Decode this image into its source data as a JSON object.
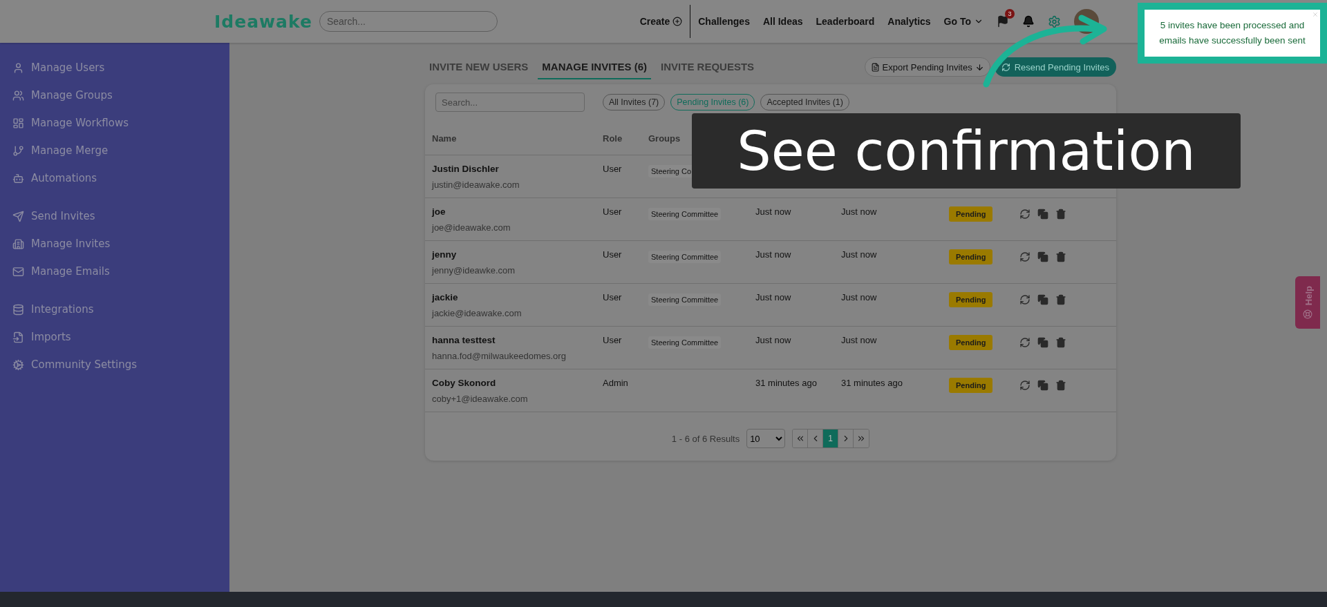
{
  "header": {
    "logo": "Ideawake",
    "search": {
      "placeholder": "Search..."
    },
    "nav": [
      {
        "label": "Create",
        "kind": "create"
      },
      {
        "label": "Challenges",
        "kind": "link"
      },
      {
        "label": "All Ideas",
        "kind": "link"
      },
      {
        "label": "Leaderboard",
        "kind": "link"
      },
      {
        "label": "Analytics",
        "kind": "link"
      },
      {
        "label": "Go To",
        "kind": "dropdown"
      }
    ],
    "flag_badge": "3"
  },
  "sidebar": {
    "groups": [
      {
        "items": [
          {
            "label": "Manage Users"
          },
          {
            "label": "Manage Groups"
          },
          {
            "label": "Manage Workflows"
          },
          {
            "label": "Manage Merge"
          },
          {
            "label": "Automations"
          }
        ]
      },
      {
        "items": [
          {
            "label": "Send Invites"
          },
          {
            "label": "Manage Invites"
          },
          {
            "label": "Manage Emails"
          }
        ]
      },
      {
        "items": [
          {
            "label": "Integrations"
          },
          {
            "label": "Imports"
          },
          {
            "label": "Community Settings"
          }
        ]
      }
    ]
  },
  "tabs": [
    {
      "label": "INVITE NEW USERS",
      "selected": false
    },
    {
      "label": "MANAGE INVITES (6)",
      "selected": true
    },
    {
      "label": "INVITE REQUESTS",
      "selected": false
    }
  ],
  "actions": {
    "export": "Export Pending Invites",
    "resend": "Resend Pending Invites"
  },
  "invites": {
    "search": {
      "placeholder": "Search..."
    },
    "filters": [
      {
        "label": "All Invites (7)",
        "selected": false
      },
      {
        "label": "Pending Invites (6)",
        "selected": true
      },
      {
        "label": "Accepted Invites (1)",
        "selected": false
      }
    ],
    "columns": [
      "Name",
      "Role",
      "Groups"
    ],
    "rows": [
      {
        "name": "Justin Dischler",
        "email": "justin@ideawake.com",
        "role": "User",
        "group": "Steering Co"
      },
      {
        "name": "joe",
        "email": "joe@ideawake.com",
        "role": "User",
        "group": "Steering Committee",
        "date_sent": "Just now",
        "recent": "Just now",
        "status": "Pending"
      },
      {
        "name": "jenny",
        "email": "jenny@ideawke.com",
        "role": "User",
        "group": "Steering Committee",
        "date_sent": "Just now",
        "recent": "Just now",
        "status": "Pending"
      },
      {
        "name": "jackie",
        "email": "jackie@ideawake.com",
        "role": "User",
        "group": "Steering Committee",
        "date_sent": "Just now",
        "recent": "Just now",
        "status": "Pending"
      },
      {
        "name": "hanna testtest",
        "email": "hanna.fod@milwaukeedomes.org",
        "role": "User",
        "group": "Steering Committee",
        "date_sent": "Just now",
        "recent": "Just now",
        "status": "Pending"
      },
      {
        "name": "Coby Skonord",
        "email": "coby+1@ideawake.com",
        "role": "Admin",
        "date_sent": "31 minutes ago",
        "recent": "31 minutes ago",
        "status": "Pending"
      }
    ],
    "pagination": {
      "summary": "1 - 6 of 6 Results",
      "page_size": "10",
      "pages": [
        {
          "label": "1",
          "selected": true
        }
      ]
    }
  },
  "help": "Help",
  "toast": {
    "message": "5 invites have been processed and emails have successfully been sent"
  },
  "caption": "See confirmation"
}
